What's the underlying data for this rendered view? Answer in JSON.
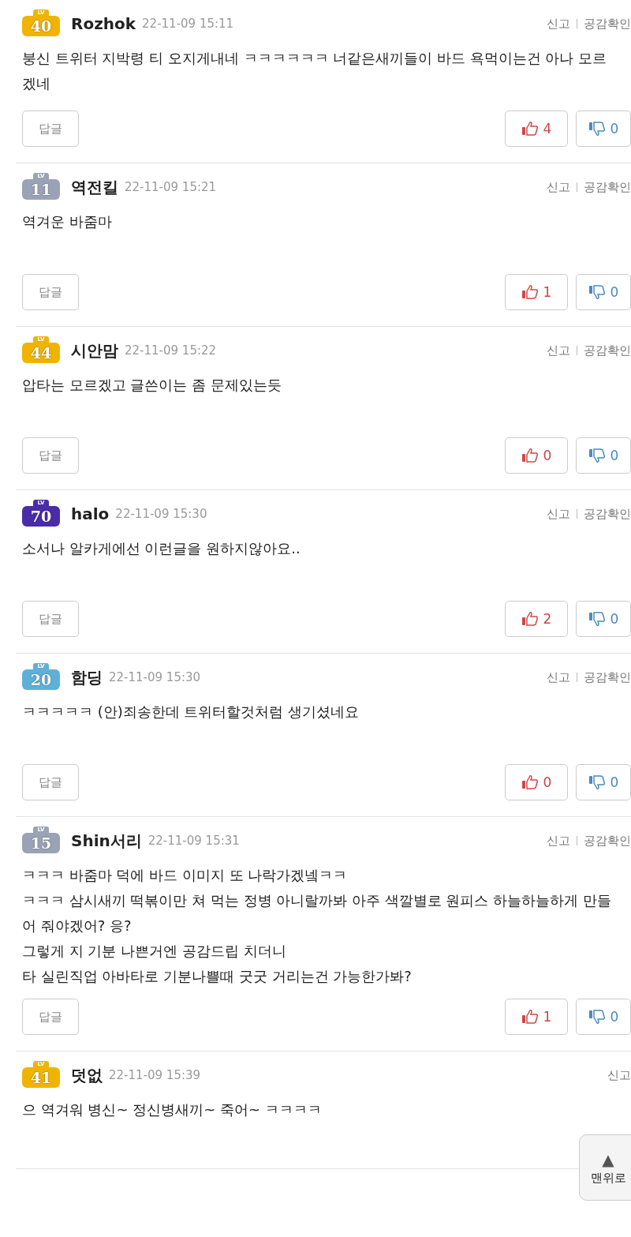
{
  "comments": [
    {
      "badge": {
        "prefix": "LV",
        "level": "40",
        "color": "#f0b400"
      },
      "author": "Rozhok",
      "date": "22-11-09 15:11",
      "actions": [
        "신고",
        "공감확인"
      ],
      "lines": [
        "붕신 트위터 지박령 티 오지게내네 ㅋㅋㅋㅋㅋㅋ 너같은새끼들이 바드 욕먹이는건 아나 모르",
        "겠네"
      ],
      "reply": "답글",
      "likes": "4",
      "dislikes": "0"
    },
    {
      "badge": {
        "prefix": "LV",
        "level": "11",
        "color": "#9aa3b5"
      },
      "author": "역전킬",
      "date": "22-11-09 15:21",
      "actions": [
        "신고",
        "공감확인"
      ],
      "lines": [
        "역겨운 바줌마"
      ],
      "reply": "답글",
      "likes": "1",
      "dislikes": "0"
    },
    {
      "badge": {
        "prefix": "LV",
        "level": "44",
        "color": "#f0b400"
      },
      "author": "시안맘",
      "date": "22-11-09 15:22",
      "actions": [
        "신고",
        "공감확인"
      ],
      "lines": [
        "압타는 모르겠고 글쓴이는 좀 문제있는듯"
      ],
      "reply": "답글",
      "likes": "0",
      "dislikes": "0"
    },
    {
      "badge": {
        "prefix": "LV",
        "level": "70",
        "color": "#4b2ca8"
      },
      "author": "halo",
      "date": "22-11-09 15:30",
      "actions": [
        "신고",
        "공감확인"
      ],
      "lines": [
        "소서나 알카게에선 이런글을 원하지않아요.."
      ],
      "reply": "답글",
      "likes": "2",
      "dislikes": "0"
    },
    {
      "badge": {
        "prefix": "LV",
        "level": "20",
        "color": "#5fb0d8"
      },
      "author": "함딩",
      "date": "22-11-09 15:30",
      "actions": [
        "신고",
        "공감확인"
      ],
      "lines": [
        "ㅋㅋㅋㅋㅋ (안)죄송한데 트위터할것처럼 생기셨네요"
      ],
      "reply": "답글",
      "likes": "0",
      "dislikes": "0"
    },
    {
      "badge": {
        "prefix": "LV",
        "level": "15",
        "color": "#9aa3b5"
      },
      "author": "Shin서리",
      "date": "22-11-09 15:31",
      "actions": [
        "신고",
        "공감확인"
      ],
      "lines": [
        "ㅋㅋㅋ 바줌마 덕에 바드 이미지 또 나락가겠넼ㅋㅋ",
        "ㅋㅋㅋ 삼시새끼 떡볶이만 쳐 먹는 정병 아니랄까봐 아주 색깔별로 원피스 하늘하늘하게 만들",
        "어 줘야겠어? 응?",
        "그렇게 지 기분 나쁜거엔 공감드립 치더니",
        "타 실린직업 아바타로 기분나쁠때 굿굿 거리는건 가능한가봐?"
      ],
      "reply": "답글",
      "likes": "1",
      "dislikes": "0"
    },
    {
      "badge": {
        "prefix": "LV",
        "level": "41",
        "color": "#f0b400"
      },
      "author": "덧없",
      "date": "22-11-09 15:39",
      "actions": [
        "신고"
      ],
      "lines": [
        "으 역겨워 병신~ 정신병새끼~ 죽어~ ㅋㅋㅋㅋ"
      ]
    }
  ],
  "top_button": {
    "arrow": "▲",
    "label": "맨위로"
  }
}
